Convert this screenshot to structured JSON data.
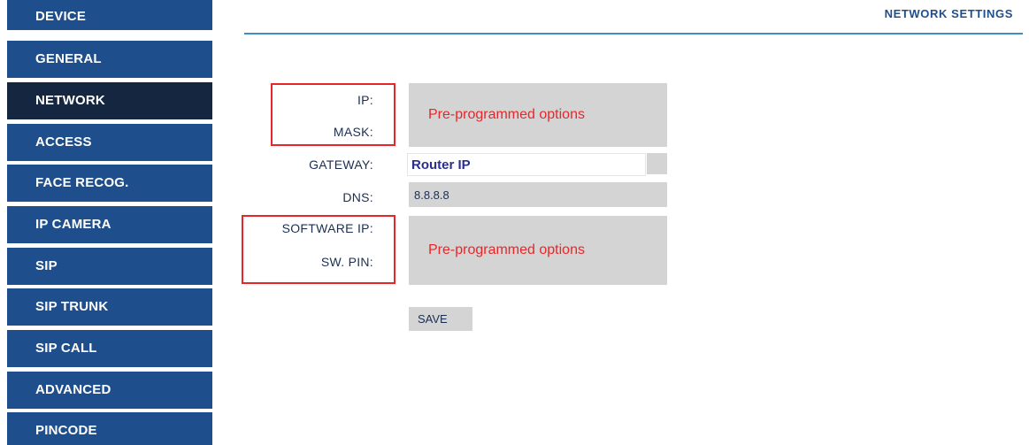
{
  "sidebar": {
    "items": [
      {
        "label": "DEVICE"
      },
      {
        "label": "GENERAL"
      },
      {
        "label": "NETWORK"
      },
      {
        "label": "ACCESS"
      },
      {
        "label": "FACE RECOG."
      },
      {
        "label": "IP CAMERA"
      },
      {
        "label": "SIP"
      },
      {
        "label": "SIP TRUNK"
      },
      {
        "label": "SIP CALL"
      },
      {
        "label": "ADVANCED"
      },
      {
        "label": "PINCODE"
      }
    ],
    "active_item": "NETWORK"
  },
  "header": {
    "title": "NETWORK SETTINGS"
  },
  "form": {
    "ip_label": "IP:",
    "mask_label": "MASK:",
    "ip_mask_note": "Pre-programmed options",
    "gateway_label": "GATEWAY:",
    "gateway_value": "Router IP",
    "dns_label": "DNS:",
    "dns_value": "8.8.8.8",
    "software_ip_label": "SOFTWARE IP:",
    "sw_pin_label": "SW. PIN:",
    "software_note": "Pre-programmed options",
    "save_label": "SAVE"
  },
  "colors": {
    "nav_background": "#1f4e8c",
    "nav_active_background": "#142640",
    "highlight_red": "#e8262a",
    "field_gray": "#d4d4d4",
    "underline_blue": "#3b8fc9"
  }
}
